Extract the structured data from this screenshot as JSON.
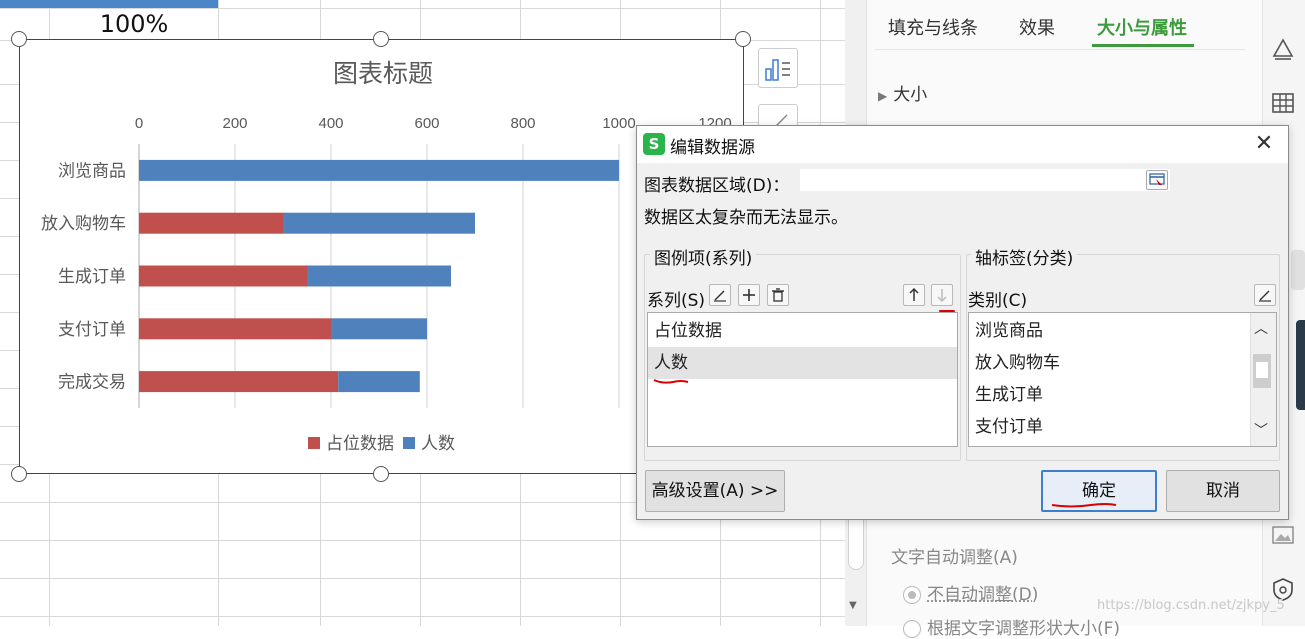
{
  "sheet": {
    "percent_cell": "100%"
  },
  "chart": {
    "title": "图表标题",
    "legend": [
      "占位数据",
      "人数"
    ]
  },
  "chart_data": {
    "type": "bar",
    "orientation": "horizontal",
    "stacked": true,
    "title": "图表标题",
    "categories": [
      "浏览商品",
      "放入购物车",
      "生成订单",
      "支付订单",
      "完成交易"
    ],
    "series": [
      {
        "name": "占位数据",
        "color": "#c0504d",
        "values": [
          0,
          300,
          350,
          400,
          415
        ]
      },
      {
        "name": "人数",
        "color": "#4f81bd",
        "values": [
          1000,
          400,
          300,
          200,
          170
        ]
      }
    ],
    "xlim": [
      0,
      1200
    ],
    "xticks": [
      0,
      200,
      400,
      600,
      800,
      1000,
      1200
    ],
    "axis_position": "top",
    "grid": true,
    "legend_position": "bottom"
  },
  "panel": {
    "tabs": [
      "填充与线条",
      "效果",
      "大小与属性"
    ],
    "size_section": "大小",
    "autofit_label": "文字自动调整(A)",
    "no_autofit": "不自动调整(D)",
    "resize_shape": "根据文字调整形状大小(F)"
  },
  "dialog": {
    "logo": "S",
    "title": "编辑数据源",
    "close": "✕",
    "range_label": "图表数据区域(D)：",
    "range_value": "",
    "complex_msg": "数据区太复杂而无法显示。",
    "series_group": "图例项(系列)",
    "series_label": "系列(S)",
    "series_items": [
      "占位数据",
      "人数"
    ],
    "axis_group": "轴标签(分类)",
    "category_label": "类别(C)",
    "category_items": [
      "浏览商品",
      "放入购物车",
      "生成订单",
      "支付订单"
    ],
    "advanced": "高级设置(A) >>",
    "ok": "确定",
    "cancel": "取消"
  },
  "watermark": "https://blog.csdn.net/zjkpy_5"
}
